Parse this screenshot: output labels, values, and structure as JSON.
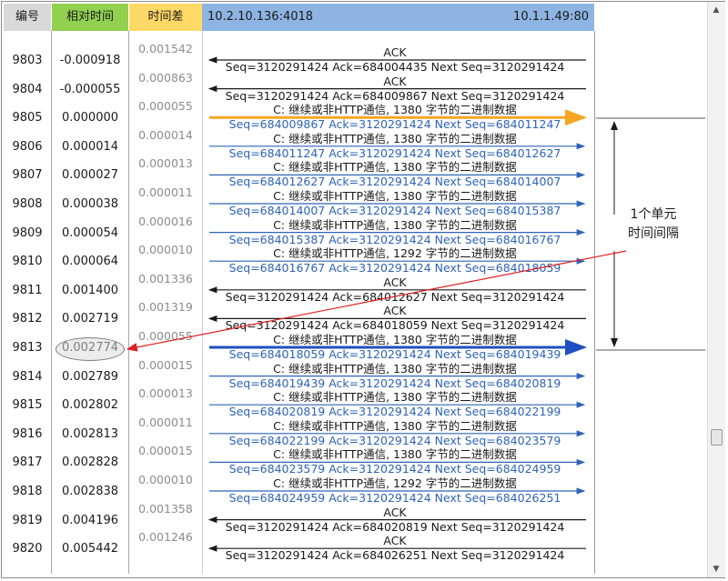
{
  "columns": {
    "no": "编号",
    "relative_time": "相对时间",
    "delta_time": "时间差",
    "source_host": "10.2.10.136:4018",
    "dest_host": "10.1.1.49:80"
  },
  "frames": [
    {
      "no": "9803",
      "rel": "-0.000918"
    },
    {
      "no": "9804",
      "rel": "-0.000055"
    },
    {
      "no": "9805",
      "rel": "0.000000"
    },
    {
      "no": "9806",
      "rel": "0.000014"
    },
    {
      "no": "9807",
      "rel": "0.000027"
    },
    {
      "no": "9808",
      "rel": "0.000038"
    },
    {
      "no": "9809",
      "rel": "0.000054"
    },
    {
      "no": "9810",
      "rel": "0.000064"
    },
    {
      "no": "9811",
      "rel": "0.001400"
    },
    {
      "no": "9812",
      "rel": "0.002719"
    },
    {
      "no": "9813",
      "rel": "0.002774"
    },
    {
      "no": "9814",
      "rel": "0.002789"
    },
    {
      "no": "9815",
      "rel": "0.002802"
    },
    {
      "no": "9816",
      "rel": "0.002813"
    },
    {
      "no": "9817",
      "rel": "0.002828"
    },
    {
      "no": "9818",
      "rel": "0.002838"
    },
    {
      "no": "9819",
      "rel": "0.004196"
    },
    {
      "no": "9820",
      "rel": "0.005442"
    }
  ],
  "deltas": [
    "0.001542",
    "0.000863",
    "0.000055",
    "0.000014",
    "0.000013",
    "0.000011",
    "0.000016",
    "0.000010",
    "0.001336",
    "0.001319",
    "0.000055",
    "0.000015",
    "0.000013",
    "0.000011",
    "0.000015",
    "0.000010",
    "0.001358",
    "0.001246"
  ],
  "packets": [
    {
      "dir": "left",
      "top": "ACK",
      "bottom": "Seq=3120291424  Ack=684004435  Next Seq=3120291424"
    },
    {
      "dir": "left",
      "top": "ACK",
      "bottom": "Seq=3120291424  Ack=684009867  Next Seq=3120291424"
    },
    {
      "dir": "right",
      "top": "C: 继续或非HTTP通信, 1380 字节的二进制数据",
      "bottom": "Seq=684009867  Ack=3120291424  Next Seq=684011247"
    },
    {
      "dir": "right",
      "top": "C: 继续或非HTTP通信, 1380 字节的二进制数据",
      "bottom": "Seq=684011247  Ack=3120291424  Next Seq=684012627"
    },
    {
      "dir": "right",
      "top": "C: 继续或非HTTP通信, 1380 字节的二进制数据",
      "bottom": "Seq=684012627  Ack=3120291424  Next Seq=684014007"
    },
    {
      "dir": "right",
      "top": "C: 继续或非HTTP通信, 1380 字节的二进制数据",
      "bottom": "Seq=684014007  Ack=3120291424  Next Seq=684015387"
    },
    {
      "dir": "right",
      "top": "C: 继续或非HTTP通信, 1380 字节的二进制数据",
      "bottom": "Seq=684015387  Ack=3120291424  Next Seq=684016767"
    },
    {
      "dir": "right",
      "top": "C: 继续或非HTTP通信, 1292 字节的二进制数据",
      "bottom": "Seq=684016767  Ack=3120291424  Next Seq=684018059"
    },
    {
      "dir": "left",
      "top": "ACK",
      "bottom": "Seq=3120291424  Ack=684012627  Next Seq=3120291424"
    },
    {
      "dir": "left",
      "top": "ACK",
      "bottom": "Seq=3120291424  Ack=684018059  Next Seq=3120291424"
    },
    {
      "dir": "right",
      "top": "C: 继续或非HTTP通信, 1380 字节的二进制数据",
      "bottom": "Seq=684018059  Ack=3120291424  Next Seq=684019439"
    },
    {
      "dir": "right",
      "top": "C: 继续或非HTTP通信, 1380 字节的二进制数据",
      "bottom": "Seq=684019439  Ack=3120291424  Next Seq=684020819"
    },
    {
      "dir": "right",
      "top": "C: 继续或非HTTP通信, 1380 字节的二进制数据",
      "bottom": "Seq=684020819  Ack=3120291424  Next Seq=684022199"
    },
    {
      "dir": "right",
      "top": "C: 继续或非HTTP通信, 1380 字节的二进制数据",
      "bottom": "Seq=684022199  Ack=3120291424  Next Seq=684023579"
    },
    {
      "dir": "right",
      "top": "C: 继续或非HTTP通信, 1380 字节的二进制数据",
      "bottom": "Seq=684023579  Ack=3120291424  Next Seq=684024959"
    },
    {
      "dir": "right",
      "top": "C: 继续或非HTTP通信, 1292 字节的二进制数据",
      "bottom": "Seq=684024959  Ack=3120291424  Next Seq=684026251"
    },
    {
      "dir": "left",
      "top": "ACK",
      "bottom": "Seq=3120291424  Ack=684020819  Next Seq=3120291424"
    },
    {
      "dir": "left",
      "top": "ACK",
      "bottom": "Seq=3120291424  Ack=684026251  Next Seq=3120291424"
    }
  ],
  "highlight": {
    "frame": "9813",
    "value": "0.002774"
  },
  "annotation": {
    "line1": "1个单元",
    "line2": "时间间隔"
  },
  "colors": {
    "ack_arrow": "#1a1a1a",
    "data_arrow": "#2e64b8",
    "first_burst_arrow": "#f5a623",
    "second_burst_arrow": "#1f4fc1",
    "pointer_arrow": "#e02020",
    "data_text": "#2e64b8"
  }
}
